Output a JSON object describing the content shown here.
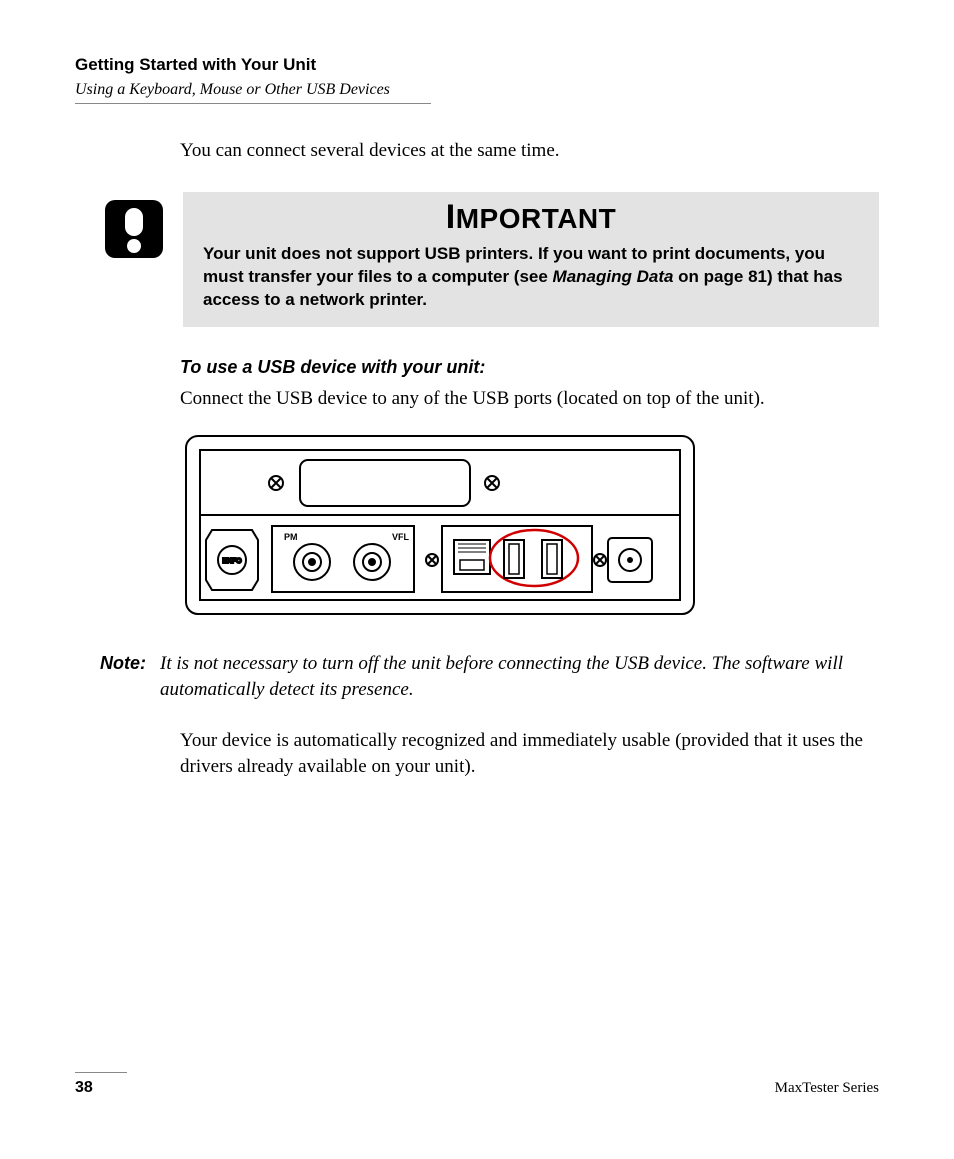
{
  "header": {
    "title": "Getting Started with Your Unit",
    "subtitle": "Using a Keyboard, Mouse or Other USB Devices"
  },
  "intro": "You can connect several devices at the same time.",
  "important": {
    "heading": "IMPORTANT",
    "body_pre": "Your unit does not support USB printers. If you want to print documents, you must transfer your files to a computer (see ",
    "body_ref": "Managing Data",
    "body_post": " on page 81) that has access to a network printer."
  },
  "instruction": {
    "heading": "To use a USB device with your unit:",
    "body": "Connect the USB device to any of the USB ports (located on top of the unit)."
  },
  "note": {
    "label": "Note:",
    "body": "It is not necessary to turn off the unit before connecting the USB device. The software will automatically detect its presence."
  },
  "after_note": "Your device is automatically recognized and immediately usable (provided that it uses the drivers already available on your unit).",
  "footer": {
    "page": "38",
    "series": "MaxTester Series"
  },
  "figure_labels": {
    "port_pm": "PM",
    "port_vfl": "VFL",
    "brand": "EXFO"
  }
}
